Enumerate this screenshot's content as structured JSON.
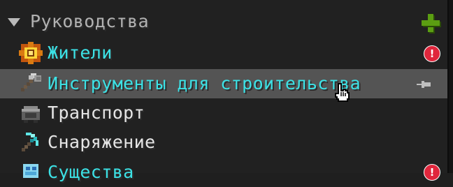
{
  "category": {
    "title": "Руководства",
    "collapse_icon": "triangle-down-icon",
    "add_icon": "plus-icon"
  },
  "items": [
    {
      "label": "Жители",
      "icon": "villager-gear-icon",
      "color": "#3ce2e6",
      "badge": "!"
    },
    {
      "label": "Инструменты для строительства",
      "icon": "hammer-icon",
      "color": "#3ce2e6",
      "selected": true,
      "pin_icon": "pin-icon"
    },
    {
      "label": "Транспорт",
      "icon": "minecart-icon",
      "color": "#e6e6e6"
    },
    {
      "label": "Снаряжение",
      "icon": "diamond-pickaxe-icon",
      "color": "#e6e6e6"
    },
    {
      "label": "Существа",
      "icon": "creature-icon",
      "color": "#3ce2e6",
      "badge": "!"
    }
  ],
  "colors": {
    "accent": "#3ce2e6",
    "selected_bg": "#545454",
    "alert": "#e0263c",
    "add": "#5b9e12"
  }
}
